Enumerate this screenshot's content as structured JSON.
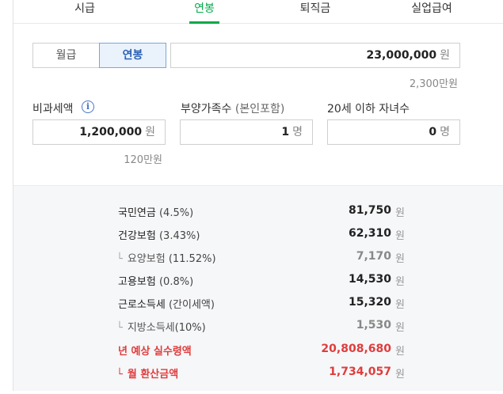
{
  "tabs": [
    {
      "label": "시급",
      "active": false
    },
    {
      "label": "연봉",
      "active": true
    },
    {
      "label": "퇴직금",
      "active": false
    },
    {
      "label": "실업급여",
      "active": false
    }
  ],
  "pay_type": {
    "monthly_label": "월급",
    "annual_label": "연봉",
    "selected": "연봉"
  },
  "salary": {
    "value": "23,000,000",
    "unit": "원",
    "summary": "2,300만원"
  },
  "nontax": {
    "label": "비과세액",
    "info_icon": "info-icon",
    "value": "1,200,000",
    "unit": "원",
    "summary": "120만원"
  },
  "dependents": {
    "label": "부양가족수",
    "paren": "(본인포함)",
    "value": "1",
    "unit": "명"
  },
  "children": {
    "label": "20세 이하 자녀수",
    "value": "0",
    "unit": "명"
  },
  "results": [
    {
      "label": "국민연금",
      "paren": "(4.5%)",
      "value": "81,750",
      "unit": "원"
    },
    {
      "label": "건강보험",
      "paren": "(3.43%)",
      "value": "62,310",
      "unit": "원"
    },
    {
      "label": "요양보험",
      "paren": "(11.52%)",
      "value": "7,170",
      "unit": "원"
    },
    {
      "label": "고용보험",
      "paren": "(0.8%)",
      "value": "14,530",
      "unit": "원"
    },
    {
      "label": "근로소득세",
      "paren": "(간이세액)",
      "value": "15,320",
      "unit": "원"
    },
    {
      "label": "지방소득세",
      "paren": "(10%)",
      "value": "1,530",
      "unit": "원"
    },
    {
      "label": "년 예상 실수령액",
      "paren": "",
      "value": "20,808,680",
      "unit": "원"
    },
    {
      "label": "월 환산금액",
      "paren": "",
      "value": "1,734,057",
      "unit": "원"
    }
  ],
  "colors": {
    "accent_green": "#03a94a",
    "selected_blue": "#2b62b5",
    "highlight_red": "#e03c3c"
  }
}
